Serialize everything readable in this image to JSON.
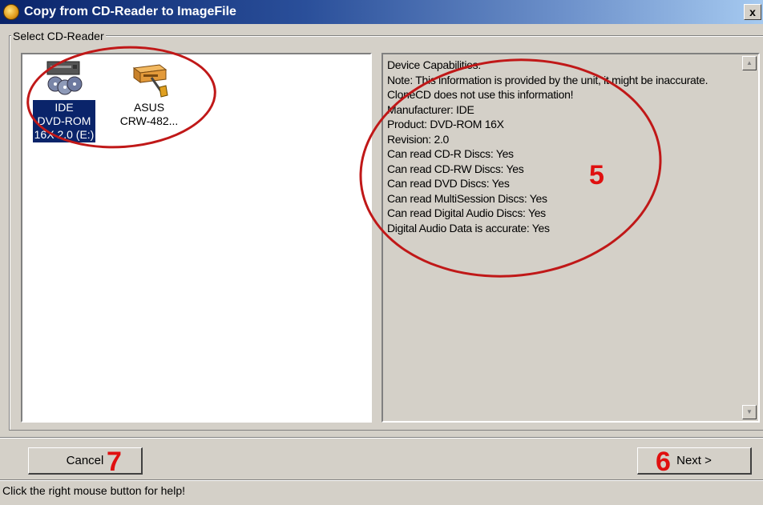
{
  "window": {
    "title": "Copy from CD-Reader to ImageFile",
    "close_label": "x"
  },
  "group": {
    "label": "Select CD-Reader"
  },
  "devices": [
    {
      "label": "IDE\nDVD-ROM\n16X 2.0 (E:)",
      "selected": true
    },
    {
      "label": "ASUS\nCRW-482...",
      "selected": false
    }
  ],
  "info": {
    "lines": [
      "Device Capabilities:",
      "Note: This information is provided by the unit, it might be inaccurate. CloneCD does not use this information!",
      "Manufacturer: IDE",
      "Product: DVD-ROM 16X",
      "Revision: 2.0",
      "Can read CD-R Discs: Yes",
      "Can read CD-RW Discs: Yes",
      "Can read DVD Discs: Yes",
      "Can read MultiSession Discs: Yes",
      "Can read Digital Audio Discs: Yes",
      "Digital Audio Data is accurate: Yes"
    ]
  },
  "buttons": {
    "cancel": "Cancel",
    "next": "Next >"
  },
  "statusbar": {
    "text": "Click the right mouse button for help!"
  },
  "annotations": {
    "a5": "5",
    "a6": "6",
    "a7": "7"
  },
  "colors": {
    "selection": "#0a246a",
    "annotation": "#e01010",
    "dialog_face": "#d4d0c8"
  }
}
